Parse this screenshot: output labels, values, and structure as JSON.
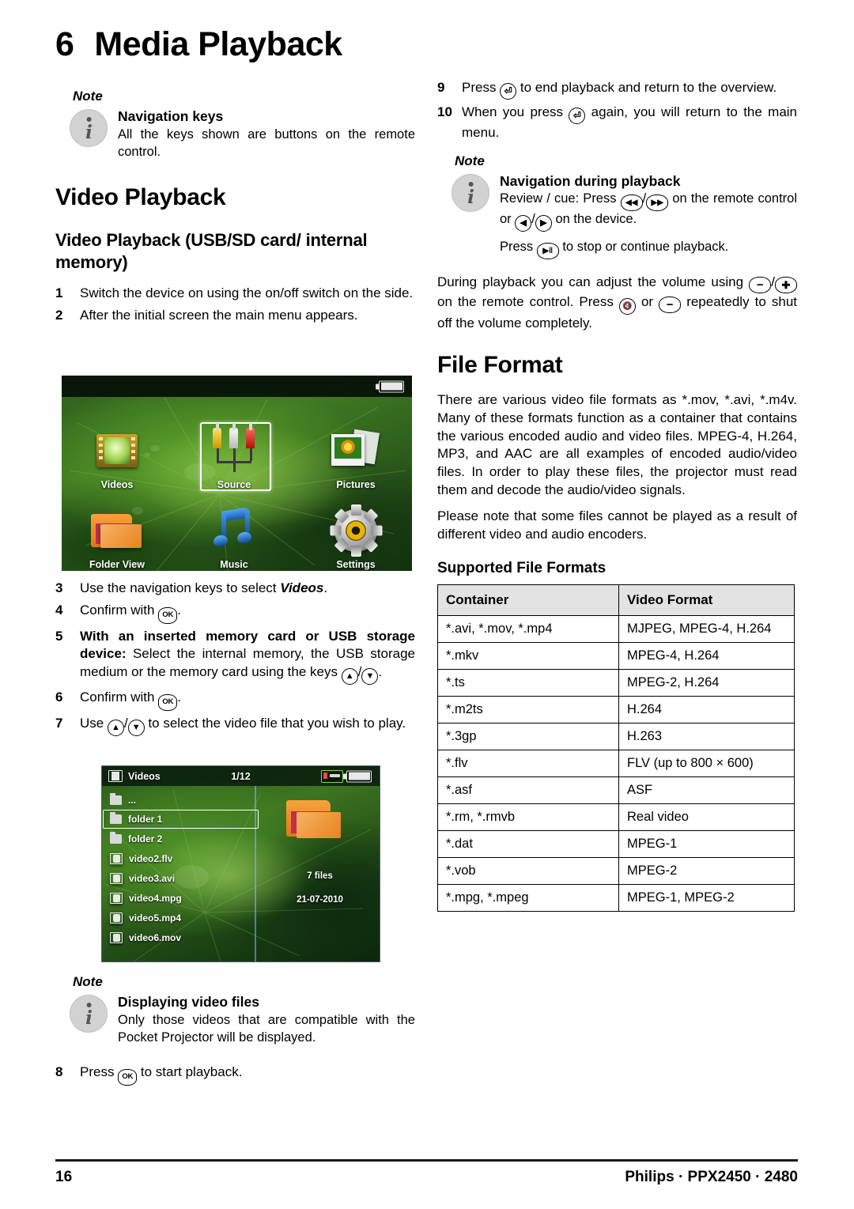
{
  "document": {
    "chapter_number": "6",
    "chapter_title": "Media Playback"
  },
  "left_column": {
    "note_top": {
      "label": "Note",
      "title": "Navigation keys",
      "body": "All the keys shown are buttons on the remote control."
    },
    "heading_section": "Video Playback",
    "heading_sub": "Video Playback (USB/SD card/ internal memory)",
    "steps": [
      {
        "n": "1",
        "text_before": "Switch the device on using the on/off switch on the side."
      },
      {
        "n": "2",
        "text_before": "After the initial screen the main menu appears."
      },
      {
        "n": "3",
        "text_before": "Use the navigation keys to select ",
        "emphasis": "Videos",
        "text_after": "."
      },
      {
        "n": "4",
        "text_before": "Confirm with ",
        "key": "OK",
        "text_after": "."
      },
      {
        "n": "5",
        "bold_lead": "With an inserted memory card or USB storage device:",
        "text_after": " Select the internal memory, the USB storage medium or the memory card using the keys ",
        "keys": "▲/▼",
        "tail": "."
      },
      {
        "n": "6",
        "text_before": "Confirm with ",
        "key": "OK",
        "text_after": "."
      },
      {
        "n": "7",
        "text_before": "Use ",
        "keys": "▲/▼",
        "text_after": " to select the video file that you wish to play."
      },
      {
        "n": "8",
        "text_before": "Press ",
        "key": "OK",
        "text_after": " to start playback."
      }
    ],
    "note_bottom": {
      "label": "Note",
      "title": "Displaying video files",
      "body": "Only those videos that are compatible with the Pocket Projector will be displayed."
    }
  },
  "screenshot_main_menu": {
    "name": "main-menu",
    "battery_icon": "battery-icon",
    "selected_item": "Source",
    "items": [
      {
        "label": "Videos",
        "icon": "film-icon"
      },
      {
        "label": "Source",
        "icon": "rca-cables-icon"
      },
      {
        "label": "Pictures",
        "icon": "photos-icon"
      },
      {
        "label": "Folder View",
        "icon": "folder-icon"
      },
      {
        "label": "Music",
        "icon": "music-note-icon"
      },
      {
        "label": "Settings",
        "icon": "gear-icon"
      }
    ]
  },
  "screenshot_file_browser": {
    "name": "video-file-browser",
    "title": "Videos",
    "counter": "1/12",
    "usb_icon": "usb-card-icon",
    "battery_icon": "battery-icon",
    "selected_row": "folder 1",
    "rows": [
      {
        "label": "...",
        "icon": "folder-icon"
      },
      {
        "label": "folder 1",
        "icon": "folder-icon"
      },
      {
        "label": "folder 2",
        "icon": "folder-icon"
      },
      {
        "label": "video2.flv",
        "icon": "film-icon"
      },
      {
        "label": "video3.avi",
        "icon": "film-icon"
      },
      {
        "label": "video4.mpg",
        "icon": "film-icon"
      },
      {
        "label": "video5.mp4",
        "icon": "film-icon"
      },
      {
        "label": "video6.mov",
        "icon": "film-icon"
      }
    ],
    "detail_files": "7 files",
    "detail_date": "21-07-2010"
  },
  "right_column": {
    "steps": [
      {
        "n": "9",
        "text_before": "Press ",
        "key": "return",
        "text_after": " to end playback and return to the overview."
      },
      {
        "n": "10",
        "text_before": "When you press ",
        "key": "return",
        "text_after": " again, you will return to the main menu."
      }
    ],
    "note": {
      "label": "Note",
      "title": "Navigation during playback",
      "body_1_a": "Review / cue: Press ",
      "body_1_keys": "◀◀/▶▶",
      "body_1_b": " on the remote control or ",
      "body_1_keys2": "◀/▶",
      "body_1_c": " on the device.",
      "body_2_a": "Press ",
      "body_2_key": "▶ǁ",
      "body_2_b": " to stop or continue playback."
    },
    "volume_paragraph_a": "During playback you can adjust the volume using ",
    "volume_keys_minus": "−",
    "volume_paragraph_b": " on the remote control. Press ",
    "volume_key_mute": "mute",
    "volume_paragraph_c": " or ",
    "volume_paragraph_d": " repeatedly to shut off the volume completely.",
    "volume_key_plus": "+",
    "heading_file_format": "File Format",
    "paragraph_1": "There are various video file formats as *.mov, *.avi, *.m4v. Many of these formats function as a container that contains the various encoded audio and video files. MPEG-4, H.264, MP3, and AAC are all examples of encoded audio/video files. In order to play these files, the projector must read them and decode the audio/video signals.",
    "paragraph_2": "Please note that some files cannot be played as a result of different video and audio encoders.",
    "heading_supported": "Supported File Formats",
    "table": {
      "headers": [
        "Container",
        "Video Format"
      ],
      "rows": [
        [
          "*.avi, *.mov, *.mp4",
          "MJPEG, MPEG-4, H.264"
        ],
        [
          "*.mkv",
          "MPEG-4, H.264"
        ],
        [
          "*.ts",
          "MPEG-2, H.264"
        ],
        [
          "*.m2ts",
          "H.264"
        ],
        [
          "*.3gp",
          "H.263"
        ],
        [
          "*.flv",
          "FLV (up to 800 × 600)"
        ],
        [
          "*.asf",
          "ASF"
        ],
        [
          "*.rm, *.rmvb",
          "Real video"
        ],
        [
          "*.dat",
          "MPEG-1"
        ],
        [
          "*.vob",
          "MPEG-2"
        ],
        [
          "*.mpg, *.mpeg",
          "MPEG-1, MPEG-2"
        ]
      ]
    }
  },
  "footer": {
    "page_number": "16",
    "product": "Philips · PPX2450 · 2480"
  }
}
